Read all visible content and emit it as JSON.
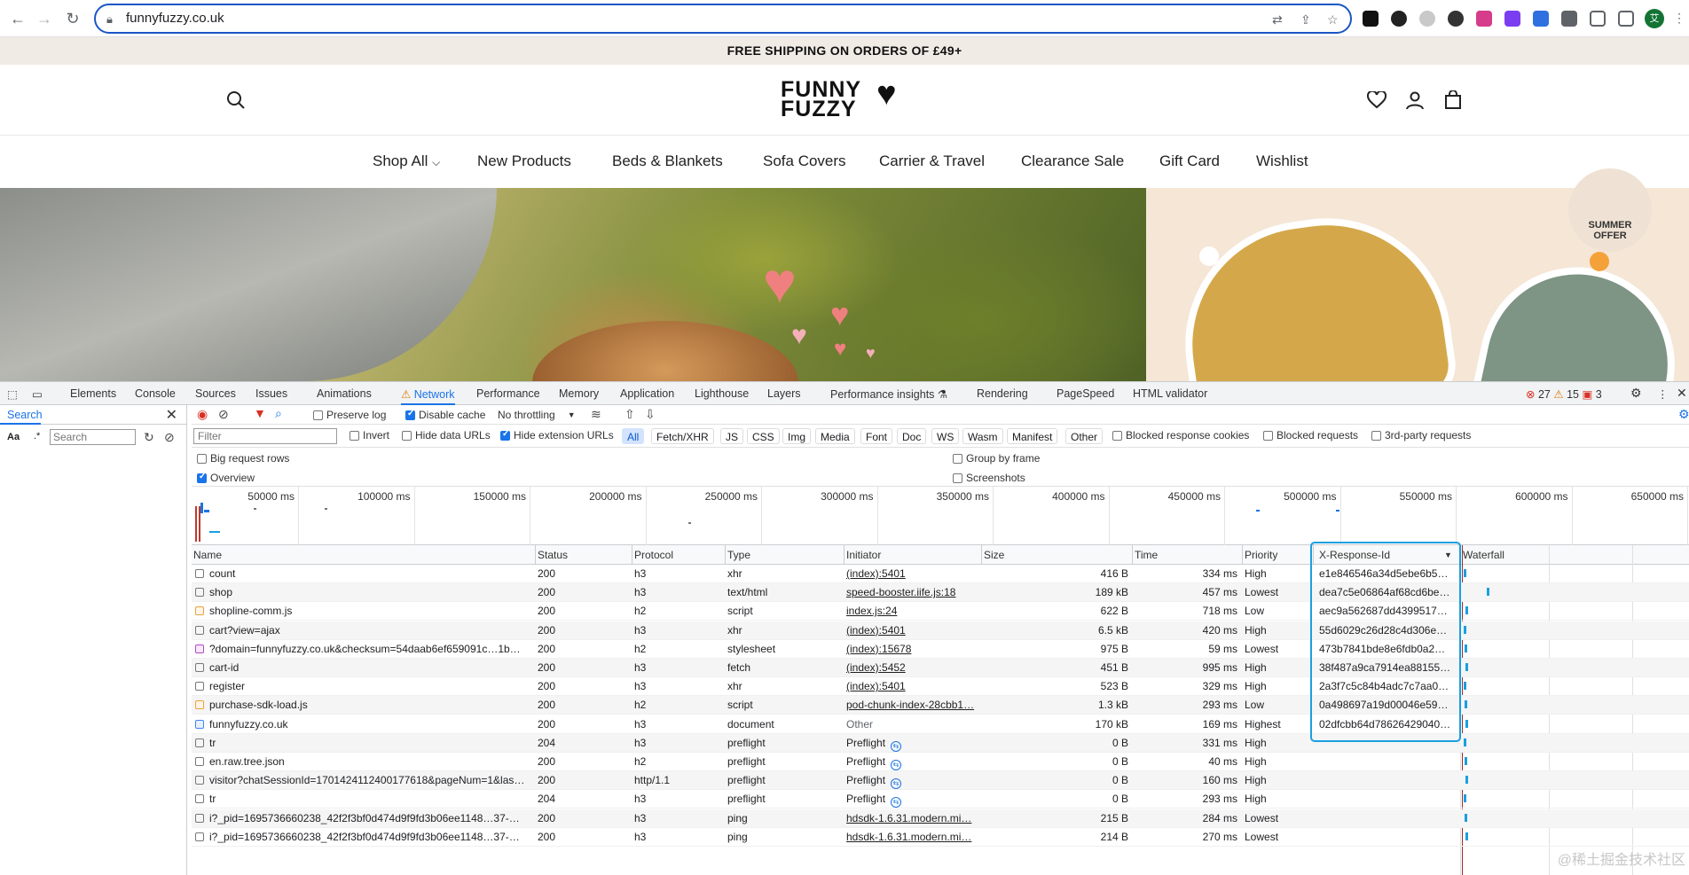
{
  "browser": {
    "url": "funnyfuzzy.co.uk",
    "back_icon": "arrow-left-icon",
    "forward_icon": "arrow-right-icon",
    "reload_icon": "reload-icon",
    "lock_icon": "lock-icon",
    "profile_initial": "艾"
  },
  "site": {
    "announcement": "FREE SHIPPING ON ORDERS OF £49+",
    "logo_line1": "FUNNY",
    "logo_line2": "FUZZY",
    "nav": [
      "Shop All",
      "New Products",
      "Beds & Blankets",
      "Sofa Covers",
      "Carrier & Travel",
      "Clearance Sale",
      "Gift Card",
      "Wishlist"
    ],
    "offer_badge_line1": "SUMMER",
    "offer_badge_line2": "OFFER"
  },
  "devtools": {
    "tabs": [
      "Elements",
      "Console",
      "Sources",
      "Issues",
      "Animations",
      "Network",
      "Performance",
      "Memory",
      "Application",
      "Lighthouse",
      "Layers",
      "Performance insights",
      "Rendering",
      "PageSpeed",
      "HTML validator"
    ],
    "active_tab": "Network",
    "errors": "27",
    "warnings": "15",
    "issues": "3",
    "search_panel": {
      "title": "Search",
      "aa_label": "Aa",
      "regex_label": ".*",
      "placeholder": "Search"
    },
    "toolbar": {
      "preserve_log": "Preserve log",
      "disable_cache": "Disable cache",
      "throttling": "No throttling"
    },
    "filter": {
      "placeholder": "Filter",
      "invert": "Invert",
      "hide_data_urls": "Hide data URLs",
      "hide_extension_urls": "Hide extension URLs",
      "chips": [
        "All",
        "Fetch/XHR",
        "JS",
        "CSS",
        "Img",
        "Media",
        "Font",
        "Doc",
        "WS",
        "Wasm",
        "Manifest",
        "Other"
      ],
      "blocked_response_cookies": "Blocked response cookies",
      "blocked_requests": "Blocked requests",
      "third_party": "3rd-party requests"
    },
    "options": {
      "big_rows": "Big request rows",
      "overview": "Overview",
      "group_by_frame": "Group by frame",
      "screenshots": "Screenshots"
    },
    "overview_ticks": [
      "50000 ms",
      "100000 ms",
      "150000 ms",
      "200000 ms",
      "250000 ms",
      "300000 ms",
      "350000 ms",
      "400000 ms",
      "450000 ms",
      "500000 ms",
      "550000 ms",
      "600000 ms",
      "650000 ms"
    ],
    "columns": [
      "Name",
      "Status",
      "Protocol",
      "Type",
      "Initiator",
      "Size",
      "Time",
      "Priority",
      "X-Response-Id",
      "Waterfall"
    ],
    "rows": [
      {
        "name": "count",
        "status": "200",
        "protocol": "h3",
        "type": "xhr",
        "initiator": "(index):5401",
        "size": "416 B",
        "time": "334 ms",
        "priority": "High",
        "xid": "e1e846546a34d5ebe6b5…",
        "icon": "plain",
        "link": true
      },
      {
        "name": "shop",
        "status": "200",
        "protocol": "h3",
        "type": "text/html",
        "initiator": "speed-booster.iife.js:18",
        "size": "189 kB",
        "time": "457 ms",
        "priority": "Lowest",
        "xid": "dea7c5e06864af68cd6be…",
        "icon": "plain",
        "link": true
      },
      {
        "name": "shopline-comm.js",
        "status": "200",
        "protocol": "h2",
        "type": "script",
        "initiator": "index.js:24",
        "size": "622 B",
        "time": "718 ms",
        "priority": "Low",
        "xid": "aec9a562687dd4399517…",
        "icon": "js",
        "link": true
      },
      {
        "name": "cart?view=ajax",
        "status": "200",
        "protocol": "h3",
        "type": "xhr",
        "initiator": "(index):5401",
        "size": "6.5 kB",
        "time": "420 ms",
        "priority": "High",
        "xid": "55d6029c26d28c4d306e…",
        "icon": "plain",
        "link": true
      },
      {
        "name": "?domain=funnyfuzzy.co.uk&checksum=54daab6ef659091c…1b…",
        "status": "200",
        "protocol": "h2",
        "type": "stylesheet",
        "initiator": "(index):15678",
        "size": "975 B",
        "time": "59 ms",
        "priority": "Lowest",
        "xid": "473b7841bde8e6fdb0a2…",
        "icon": "css",
        "link": true
      },
      {
        "name": "cart-id",
        "status": "200",
        "protocol": "h3",
        "type": "fetch",
        "initiator": "(index):5452",
        "size": "451 B",
        "time": "995 ms",
        "priority": "High",
        "xid": "38f487a9ca7914ea88155…",
        "icon": "plain",
        "link": true
      },
      {
        "name": "register",
        "status": "200",
        "protocol": "h3",
        "type": "xhr",
        "initiator": "(index):5401",
        "size": "523 B",
        "time": "329 ms",
        "priority": "High",
        "xid": "2a3f7c5c84b4adc7c7aa0…",
        "icon": "plain",
        "link": true
      },
      {
        "name": "purchase-sdk-load.js",
        "status": "200",
        "protocol": "h2",
        "type": "script",
        "initiator": "pod-chunk-index-28cbb1…",
        "size": "1.3 kB",
        "time": "293 ms",
        "priority": "Low",
        "xid": "0a498697a19d00046e59…",
        "icon": "js",
        "link": true
      },
      {
        "name": "funnyfuzzy.co.uk",
        "status": "200",
        "protocol": "h3",
        "type": "document",
        "initiator": "Other",
        "size": "170 kB",
        "time": "169 ms",
        "priority": "Highest",
        "xid": "02dfcbb64d78626429040…",
        "icon": "doc",
        "link": false
      },
      {
        "name": "tr",
        "status": "204",
        "protocol": "h3",
        "type": "preflight",
        "initiator": "Preflight",
        "size": "0 B",
        "time": "331 ms",
        "priority": "High",
        "xid": "",
        "icon": "plain",
        "link": false,
        "preflight": true
      },
      {
        "name": "en.raw.tree.json",
        "status": "200",
        "protocol": "h2",
        "type": "preflight",
        "initiator": "Preflight",
        "size": "0 B",
        "time": "40 ms",
        "priority": "High",
        "xid": "",
        "icon": "plain",
        "link": false,
        "preflight": true
      },
      {
        "name": "visitor?chatSessionId=1701424112400177618&pageNum=1&las…",
        "status": "200",
        "protocol": "http/1.1",
        "type": "preflight",
        "initiator": "Preflight",
        "size": "0 B",
        "time": "160 ms",
        "priority": "High",
        "xid": "",
        "icon": "plain",
        "link": false,
        "preflight": true
      },
      {
        "name": "tr",
        "status": "204",
        "protocol": "h3",
        "type": "preflight",
        "initiator": "Preflight",
        "size": "0 B",
        "time": "293 ms",
        "priority": "High",
        "xid": "",
        "icon": "plain",
        "link": false,
        "preflight": true
      },
      {
        "name": "i?_pid=1695736660238_42f2f3bf0d474d9f9fd3b06ee1148…37-…",
        "status": "200",
        "protocol": "h3",
        "type": "ping",
        "initiator": "hdsdk-1.6.31.modern.mi…",
        "size": "215 B",
        "time": "284 ms",
        "priority": "Lowest",
        "xid": "",
        "icon": "plain",
        "link": true
      },
      {
        "name": "i?_pid=1695736660238_42f2f3bf0d474d9f9fd3b06ee1148…37-…",
        "status": "200",
        "protocol": "h3",
        "type": "ping",
        "initiator": "hdsdk-1.6.31.modern.mi…",
        "size": "214 B",
        "time": "270 ms",
        "priority": "Lowest",
        "xid": "",
        "icon": "plain",
        "link": true
      }
    ]
  },
  "watermark": "@稀土掘金技术社区"
}
